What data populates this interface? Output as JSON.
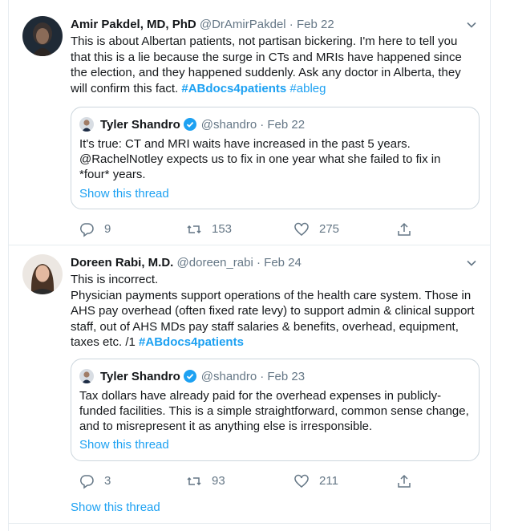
{
  "tweets": [
    {
      "author": "Amir Pakdel, MD, PhD",
      "handle": "@DrAmirPakdel",
      "date": "· Feb 22",
      "text": "This is about Albertan patients, not partisan bickering. I'm here to tell you that this is a lie because the surge in CTs and MRIs have happened since the election, and they happened suddenly. Ask any doctor in Alberta, they will confirm this fact.",
      "hashtags": [
        "#ABdocs4patients",
        "#ableg"
      ],
      "quote": {
        "author": "Tyler Shandro",
        "handle": "@shandro",
        "date": "· Feb 22",
        "text": "It's true: CT and MRI waits have increased in the past 5 years. @RachelNotley expects us to fix in one year what she failed to fix in *four* years.",
        "show_thread": "Show this thread"
      },
      "replies": "9",
      "retweets": "153",
      "likes": "275"
    },
    {
      "author": "Doreen Rabi, M.D.",
      "handle": "@doreen_rabi",
      "date": "· Feb 24",
      "line1": "This is incorrect.",
      "text": "Physician payments support operations of the health care system.  Those in AHS pay overhead (often fixed rate levy) to support admin & clinical support staff, out of AHS MDs pay staff salaries & benefits, overhead, equipment, taxes etc. /1",
      "hashtag": "#ABdocs4patients",
      "quote": {
        "author": "Tyler Shandro",
        "handle": "@shandro",
        "date": "· Feb 23",
        "text": "Tax dollars have already paid for the overhead expenses in publicly-funded facilities. This is a simple straightforward, common sense change, and to misrepresent it as anything else is irresponsible.",
        "show_thread": "Show this thread"
      },
      "replies": "3",
      "retweets": "93",
      "likes": "211",
      "show_thread": "Show this thread"
    }
  ],
  "colors": {
    "accent": "#1da1f2",
    "muted": "#657786",
    "border": "#e6ecf0",
    "verified": "#1da1f2"
  },
  "icons": [
    "chevron-down-icon",
    "reply-icon",
    "retweet-icon",
    "like-icon",
    "share-icon",
    "verified-icon"
  ]
}
